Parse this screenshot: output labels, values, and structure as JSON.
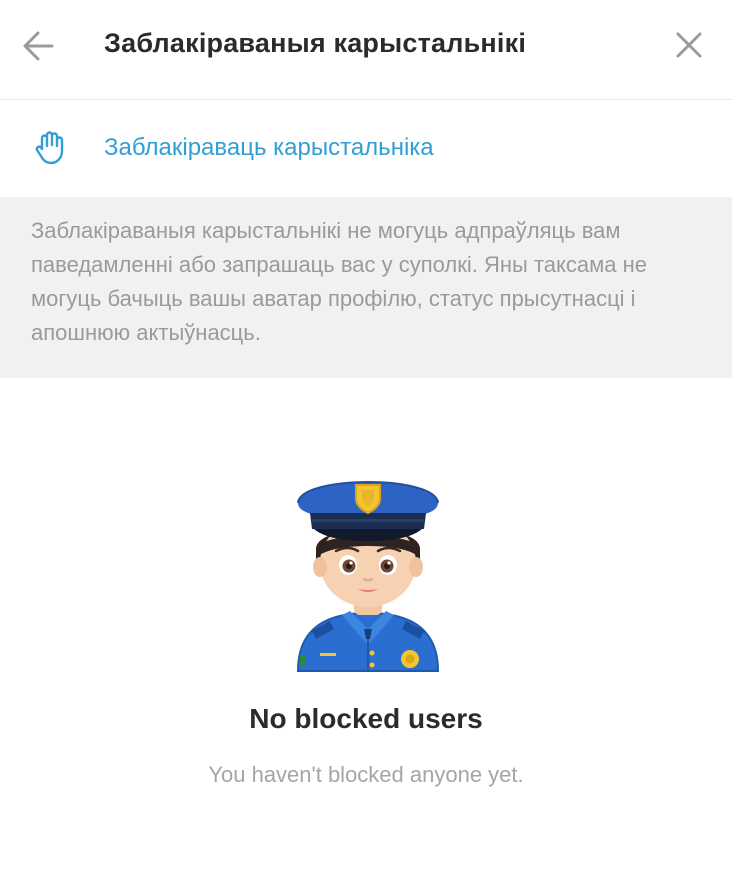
{
  "header": {
    "title": "Заблакіраваныя карыстальнікі",
    "back_icon": "arrow-left-icon",
    "close_icon": "close-icon"
  },
  "block_action": {
    "label": "Заблакіраваць карыстальніка",
    "icon": "raised-hand-icon"
  },
  "info_text": "Заблакіраваныя карыстальнікі не могуць адпраўляць вам паведамленні або запрашаць вас у суполкі. Яны таксама не могуць бачыць вашы аватар профілю, статус прысутнасці і апошнюю актыўнасць.",
  "empty_state": {
    "illustration": "police-officer-emoji",
    "title": "No blocked users",
    "subtitle": "You haven't blocked anyone yet."
  },
  "colors": {
    "accent": "#2f9fd4",
    "title_text": "#2b2b2b",
    "muted_text": "#9a9a9a",
    "info_background": "#f1f1f2",
    "icon_gray": "#9b9b9b"
  }
}
